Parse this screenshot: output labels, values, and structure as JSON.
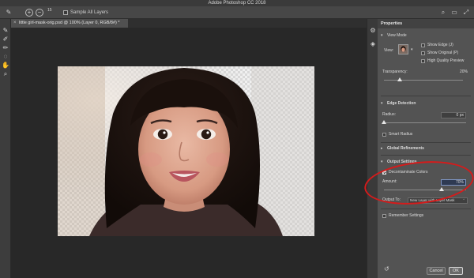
{
  "app": {
    "title": "Adobe Photoshop CC 2018"
  },
  "options_bar": {
    "sample_all_layers_label": "Sample All Layers",
    "brush_size": "15"
  },
  "document": {
    "tab_label": "little girl-mask-orig.psd @ 100% (Layer 0, RGB/8#) *"
  },
  "properties": {
    "panel_title": "Properties",
    "view_mode_label": "View Mode",
    "view_label": "View:",
    "show_edge_label": "Show Edge (J)",
    "show_original_label": "Show Original (P)",
    "high_quality_label": "High Quality Preview",
    "transparency_label": "Transparency:",
    "transparency_value": "20%",
    "transparency_level": 0.2,
    "edge_detection_label": "Edge Detection",
    "radius_label": "Radius:",
    "radius_value": "0 px",
    "radius_level": 0.0,
    "smart_radius_label": "Smart Radius",
    "global_refinements_label": "Global Refinements",
    "output_settings_label": "Output Settings",
    "decontaminate_label": "Decontaminate Colors",
    "decontaminate_checked": true,
    "amount_label": "Amount:",
    "amount_value": "70%",
    "amount_level": 0.7,
    "output_to_label": "Output To:",
    "output_to_value": "New Layer with Layer Mask",
    "remember_label": "Remember Settings",
    "cancel_label": "Cancel",
    "ok_label": "OK"
  },
  "colors": {
    "annotation_ring": "#d51b1b",
    "panel_bg": "#535353",
    "canvas_bg": "#282828"
  },
  "icons": [
    "brush-icon",
    "plus-icon",
    "minus-icon",
    "search-icon",
    "workspace-icon",
    "expand-icon",
    "quick-selection-icon",
    "refine-edge-brush-icon",
    "brush-tool-icon",
    "lasso-icon",
    "hand-icon",
    "zoom-icon",
    "properties-icon",
    "layers-icon",
    "reset-icon"
  ]
}
